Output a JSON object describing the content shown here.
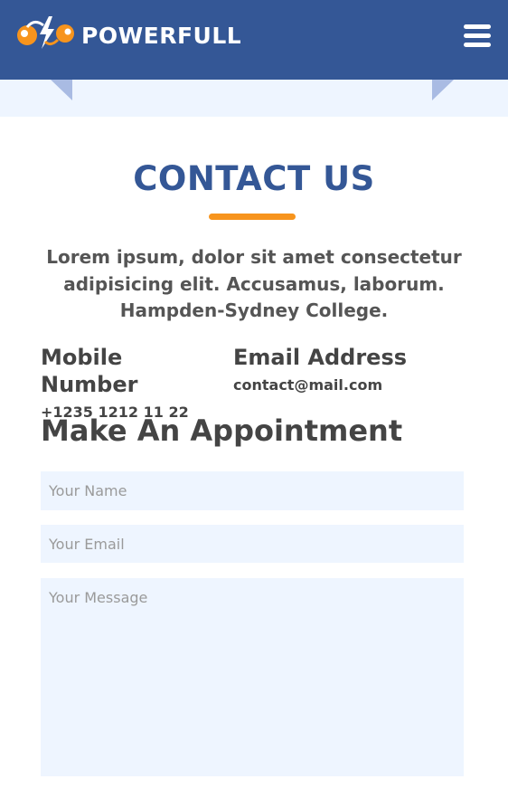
{
  "header": {
    "brand": "POWERFULL",
    "logo_icon": "battery-bolt-logo-icon",
    "menu_icon": "hamburger-menu-icon",
    "background": "#345796"
  },
  "contact": {
    "title": "CONTACT US",
    "accent_color": "#f7941d",
    "intro": "Lorem ipsum, dolor sit amet consectetur adipisicing elit. Accusamus, laborum. Hampden-Sydney College.",
    "mobile": {
      "label": "Mobile Number",
      "value": "+1235 1212 11 22"
    },
    "email": {
      "label": "Email Address",
      "value": "contact@mail.com"
    }
  },
  "appointment": {
    "title": "Make An Appointment",
    "name_placeholder": "Your Name",
    "email_placeholder": "Your Email",
    "message_placeholder": "Your Message"
  }
}
